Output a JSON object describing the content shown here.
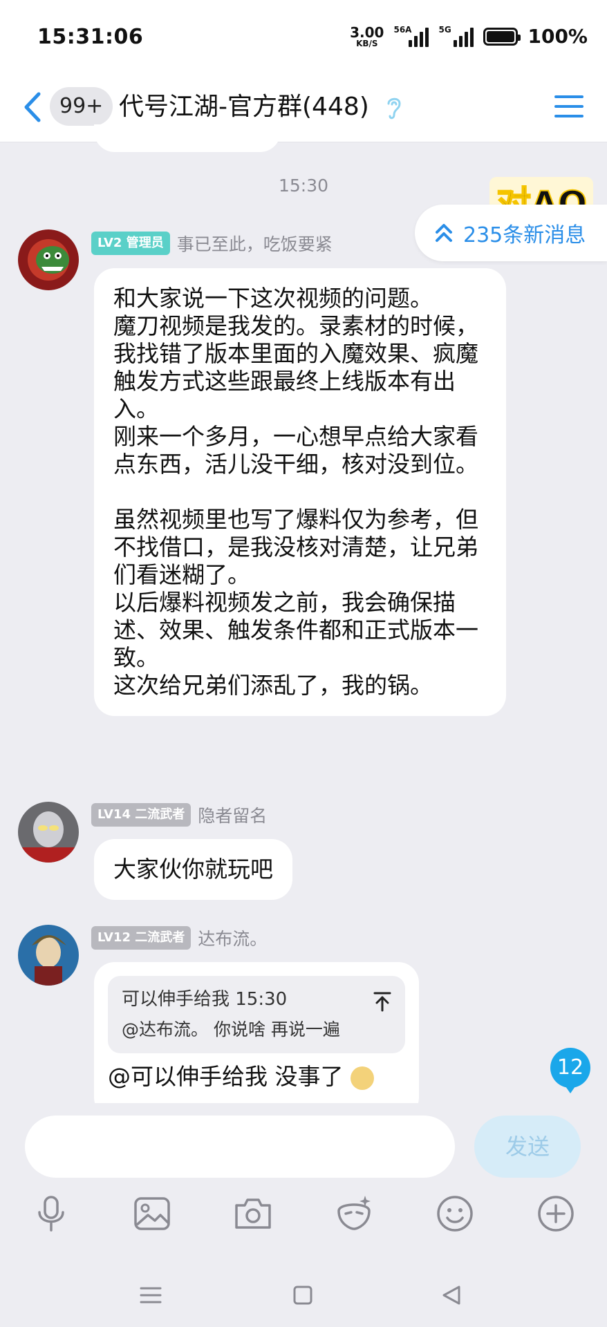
{
  "status_bar": {
    "time": "15:31:06",
    "speed_value": "3.00",
    "speed_unit": "KB/S",
    "signal1": "56A",
    "signal2": "5G",
    "battery": "100%"
  },
  "header": {
    "back_label": "<",
    "unread_badge": "99+",
    "title": "代号江湖-官方群(448)"
  },
  "timestamp": "15:30",
  "new_messages": "235条新消息",
  "messages": [
    {
      "level": "LV2 管理员",
      "nickname": "事已至此，吃饭要紧",
      "text": "和大家说一下这次视频的问题。\n魔刀视频是我发的。录素材的时候，我找错了版本里面的入魔效果、疯魔触发方式这些跟最终上线版本有出入。\n刚来一个多月，一心想早点给大家看点东西，活儿没干细，核对没到位。\n\n虽然视频里也写了爆料仅为参考，但不找借口，是我没核对清楚，让兄弟们看迷糊了。\n以后爆料视频发之前，我会确保描述、效果、触发条件都和正式版本一致。\n这次给兄弟们添乱了，我的锅。"
    },
    {
      "level": "LV14 二流武者",
      "nickname": "隐者留名",
      "text": "大家伙你就玩吧"
    },
    {
      "level": "LV12 二流武者",
      "nickname": "达布流。",
      "quote_header": "可以伸手给我 15:30",
      "quote_text": "@达布流。 你说啥  再说一遍",
      "text": "@可以伸手给我 没事了"
    }
  ],
  "unread_count": "12",
  "input": {
    "send_label": "发送"
  },
  "colors": {
    "accent": "#2a8ee8",
    "admin_badge": "#5ad0c8",
    "member_badge": "#b8b8be",
    "bubble": "#ffffff",
    "background": "#ededf2"
  },
  "icons": [
    "back-icon",
    "ear-icon",
    "menu-icon",
    "double-chevron-up-icon",
    "pin-top-icon",
    "microphone-icon",
    "image-icon",
    "camera-icon",
    "sticker-icon",
    "emoji-icon",
    "plus-icon",
    "nav-menu-icon",
    "nav-home-icon",
    "nav-back-icon"
  ]
}
